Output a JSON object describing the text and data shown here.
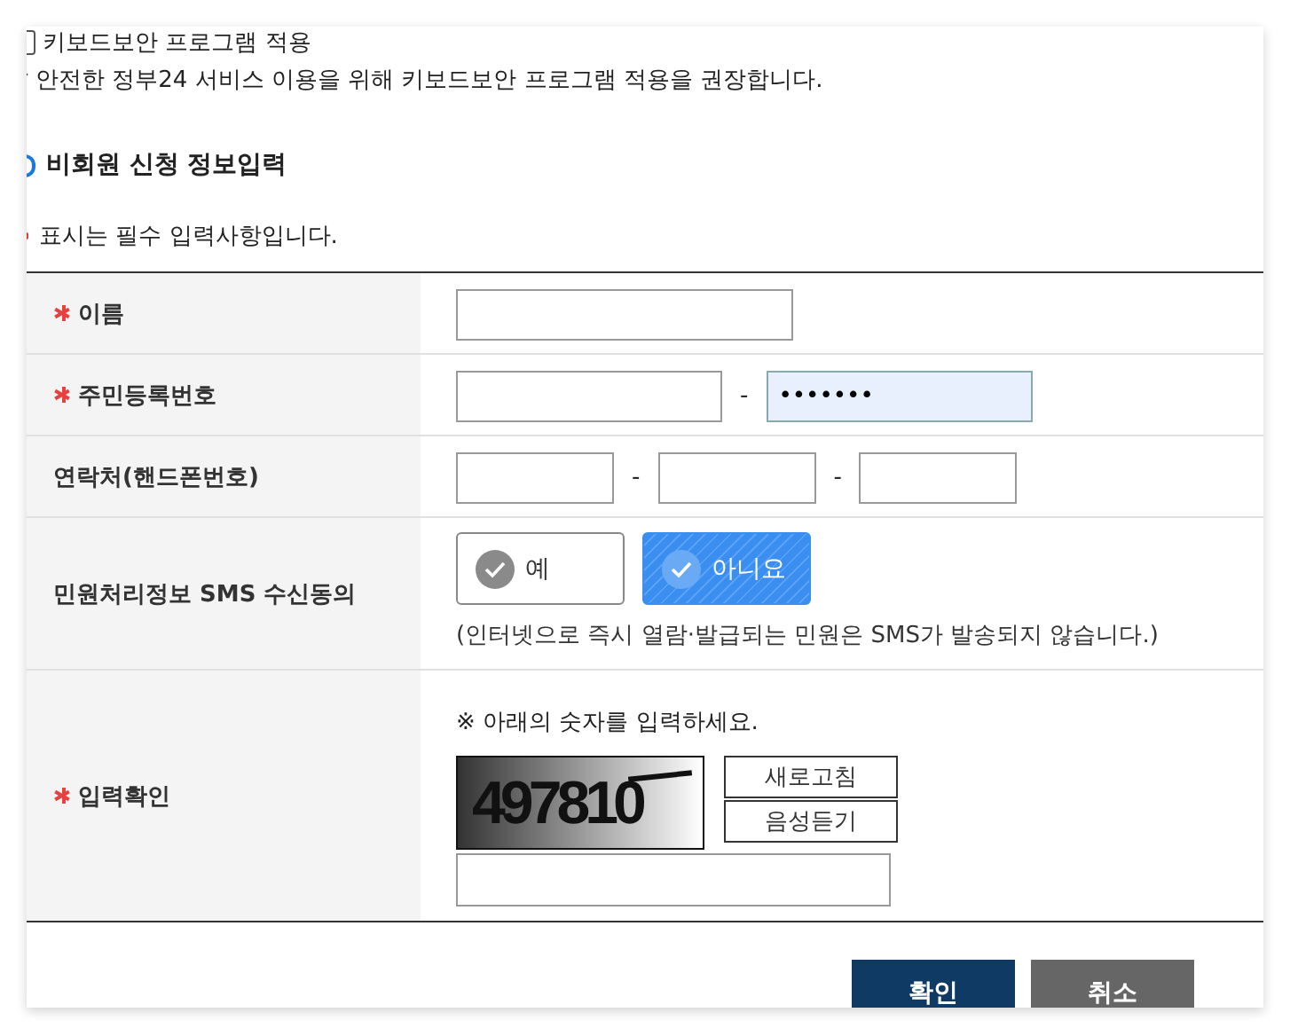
{
  "keyboard_security": {
    "label": "키보드보안 프로그램 적용",
    "checked": false
  },
  "notice": "안전한 정부24 서비스 이용을 위해 키보드보안 프로그램 적용을 권장합니다.",
  "section_title": "비회원 신청 정보입력",
  "required_note": "표시는 필수 입력사항입니다.",
  "form": {
    "rows": [
      {
        "kind": "text",
        "label": "이름",
        "required": true,
        "fields": [
          {
            "focused": false
          }
        ]
      },
      {
        "kind": "rrn",
        "label": "주민등록번호",
        "required": true,
        "separator": "-",
        "fields": [
          {
            "focused": false
          },
          {
            "value": "•••••••",
            "focused": true
          }
        ]
      },
      {
        "kind": "phone",
        "label": "연락처(핸드폰번호)",
        "required": false,
        "separator": "-",
        "fields": [
          {
            "focused": false
          },
          {
            "focused": false
          },
          {
            "focused": false
          }
        ]
      },
      {
        "kind": "choice",
        "label": "민원처리정보 SMS 수신동의",
        "required": false,
        "options": [
          {
            "label": "예",
            "selected": false
          },
          {
            "label": "아니요",
            "selected": true
          }
        ],
        "note": "(인터넷으로 즉시 열람·발급되는 민원은 SMS가 발송되지 않습니다.)"
      },
      {
        "kind": "captcha",
        "label": "입력확인",
        "required": true,
        "instruction": "※ 아래의 숫자를 입력하세요.",
        "code": "497810",
        "actions": [
          "새로고침",
          "음성듣기"
        ],
        "fields": [
          {
            "focused": false
          }
        ]
      }
    ]
  },
  "buttons": [
    {
      "label": "확인",
      "kind": "primary"
    },
    {
      "label": "취소",
      "kind": "secondary"
    }
  ]
}
